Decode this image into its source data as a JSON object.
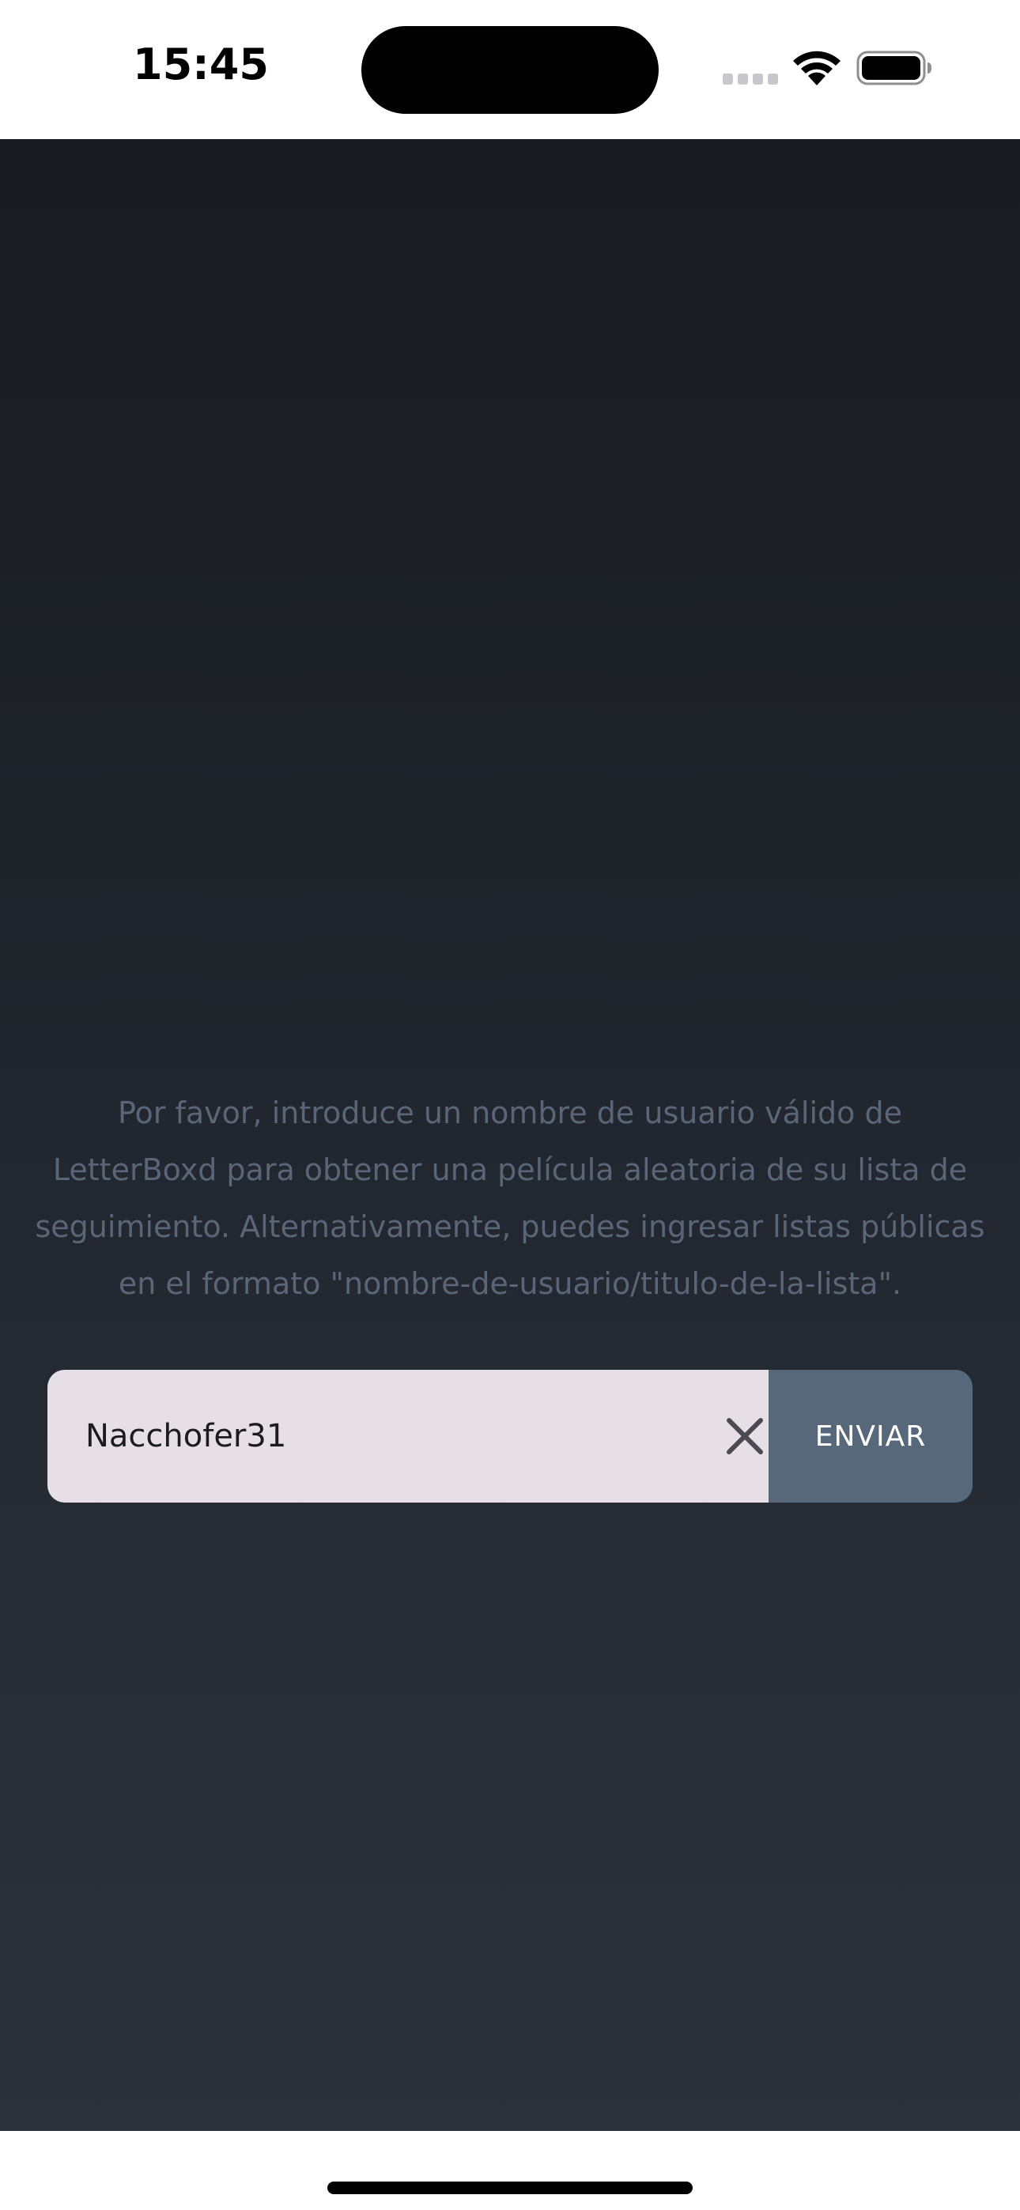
{
  "status_bar": {
    "time": "15:45",
    "icons": [
      "signal-icon",
      "wifi-icon",
      "battery-icon"
    ]
  },
  "main": {
    "instructions": "Por favor, introduce un nombre de usuario válido de LetterBoxd para obtener una película aleatoria de su lista de seguimiento. Alternativamente, puedes ingresar listas públicas en el formato \"nombre-de-usuario/titulo-de-la-lista\".",
    "username_input": {
      "value": "Nacchofer31",
      "placeholder": ""
    },
    "clear_icon": "close-icon",
    "submit_label": "ENVIAR"
  },
  "colors": {
    "background_top": "#181b20",
    "background_bottom": "#2c313b",
    "instruction_text": "#5a6677",
    "input_background": "#e6e0e6",
    "button_background": "#58687b",
    "button_text": "#ffffff"
  }
}
